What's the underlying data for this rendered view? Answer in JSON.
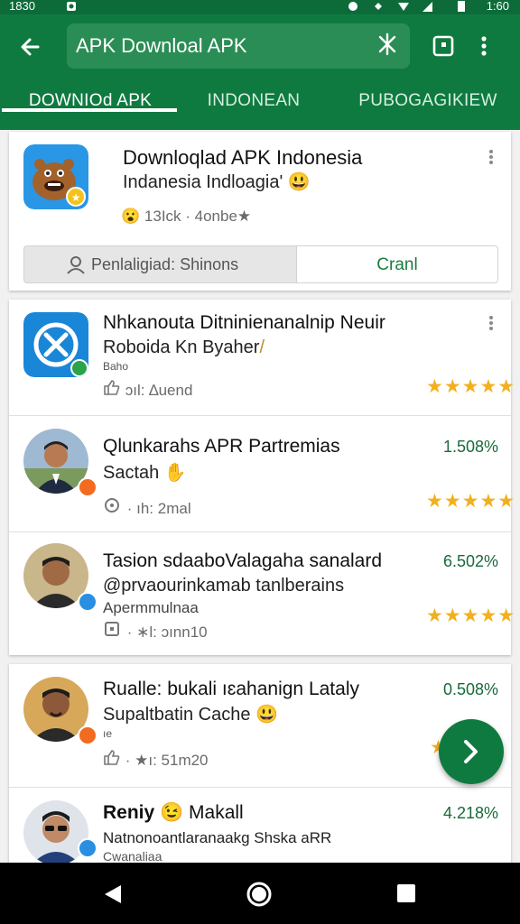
{
  "status_bar": {
    "time": "1830",
    "right_time": "1:60"
  },
  "app_bar": {
    "search_text": "APK Downloal APK",
    "tabs": [
      {
        "label": "DOWNIOd APK",
        "active": true
      },
      {
        "label": "INDONEAN",
        "active": false
      },
      {
        "label": "PUBOGAGIKIEW",
        "active": false
      }
    ]
  },
  "featured": {
    "title": "Downloqlad APK Indonesia",
    "subtitle": "Indanesia Indloagia'",
    "meta": "13Ick · 4onbe",
    "button_secondary": "Penlaligiad: Shinons",
    "button_primary": "Cranl"
  },
  "list": [
    {
      "title": "Nhkanouta Ditninienanalnip Neuir",
      "subtitle": "Roboida Kn Byaher",
      "small": "Baho",
      "meta": "ɔıl: ∆uend",
      "pct": "",
      "stars": "★★★★★"
    },
    {
      "title": "Qlunkarahs APR Partremias",
      "subtitle": "Sactah",
      "small": "",
      "meta": "· ıh: 2mal",
      "pct": "1.508%",
      "stars": "★★★★★"
    },
    {
      "title": "Tasion sdaaboValagaha sanalard",
      "subtitle": "@prvaourinkamab tanlberains",
      "small": "Apermmulnaa",
      "meta": "· ∗l: ɔınn10",
      "pct": "6.502%",
      "stars": "★★★★★"
    },
    {
      "title": "Rualle: bukali ıɛahanign Lataly",
      "subtitle": "Supaltbatin Cache",
      "small": "ıe",
      "meta": "· ★ı: 51m20",
      "pct": "0.508%",
      "stars": "★"
    },
    {
      "title": "Reniy",
      "title2": "Makall",
      "subtitle": "Natnonoantlaranaakg Shska aRR",
      "small": "Cwanaliaa",
      "meta": "",
      "pct": "4.218%",
      "stars": ""
    }
  ],
  "colors": {
    "primary": "#0f7a40",
    "star": "#f2b01e",
    "percent": "#176b3a"
  },
  "icons": [
    "back-arrow-icon",
    "clear-icon",
    "share-square-icon",
    "overflow-menu-icon",
    "chevron-right-icon",
    "nav-back-icon",
    "nav-home-icon",
    "nav-recents-icon"
  ]
}
